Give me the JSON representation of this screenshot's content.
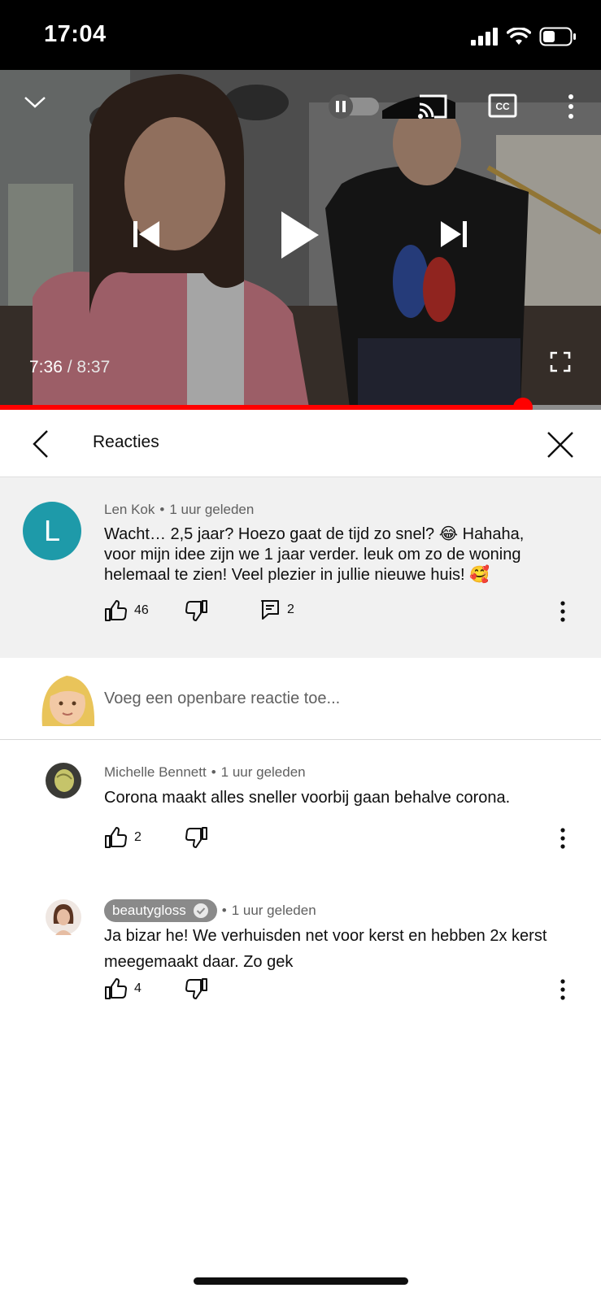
{
  "status_bar": {
    "time": "17:04"
  },
  "player": {
    "current_time": "7:36",
    "separator": " / ",
    "duration": "8:37",
    "progress_fraction": 0.87
  },
  "comments_panel": {
    "title": "Reacties"
  },
  "parent_comment": {
    "avatar_letter": "L",
    "author": "Len Kok",
    "time": "1 uur geleden",
    "text_lines": [
      "Wacht… 2,5 jaar? Hoezo gaat de tijd zo snel? 😂 Hahaha,",
      "voor mijn idee zijn we 1 jaar verder. leuk om zo de woning",
      "helemaal te zien! Veel plezier in jullie nieuwe huis! 🥰"
    ],
    "likes": "46",
    "replies": "2"
  },
  "add_reply": {
    "placeholder": "Voeg een openbare reactie toe..."
  },
  "replies": [
    {
      "author": "Michelle Bennett",
      "time": "1 uur geleden",
      "text_lines": [
        "Corona maakt alles sneller voorbij gaan behalve corona."
      ],
      "likes": "2"
    },
    {
      "author": "beautygloss",
      "time": "1 uur geleden",
      "text_lines": [
        "Ja bizar he! We verhuisden net voor kerst en hebben 2x kerst",
        "meegemaakt daar. Zo gek"
      ],
      "likes": "4"
    }
  ],
  "colors": {
    "accent_red": "#ff0000",
    "avatar_teal": "#1e9aa9",
    "highlight_bg": "#f1f1f1"
  },
  "icons": {
    "player": [
      "chevron-down-icon",
      "autoplay-toggle-icon",
      "cast-icon",
      "captions-icon",
      "more-vert-icon",
      "previous-icon",
      "play-icon",
      "next-icon",
      "fullscreen-icon"
    ],
    "comment": [
      "thumb-up-icon",
      "thumb-down-icon",
      "reply-icon",
      "more-vert-icon"
    ]
  }
}
